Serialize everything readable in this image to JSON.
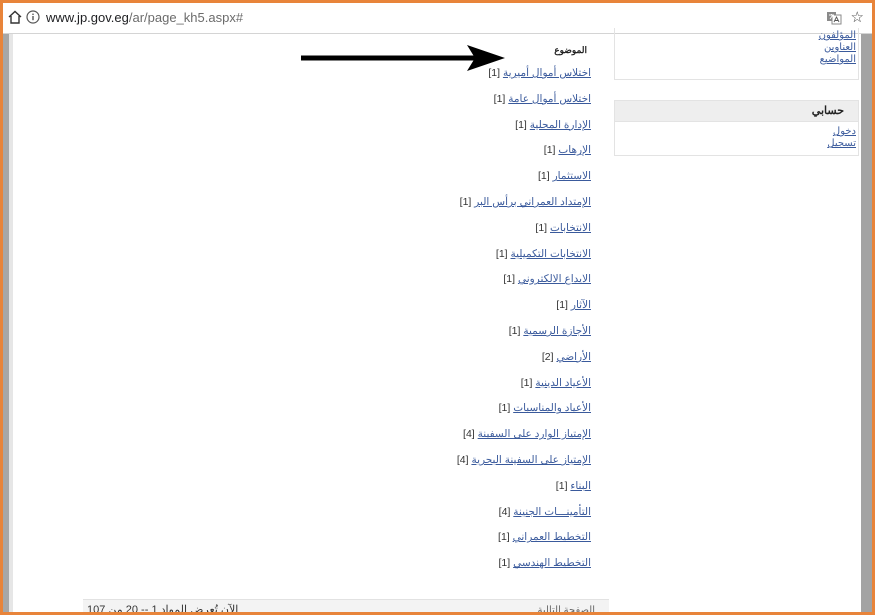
{
  "browser": {
    "url_host": "www.jp.gov.eg",
    "url_path": "/ar/page_kh5.aspx#"
  },
  "main": {
    "column_title": "الموضوع",
    "topics": [
      {
        "label": "اختلاس أموال أميرية",
        "count": "[1]"
      },
      {
        "label": "اختلاس أموال عامة",
        "count": "[1]"
      },
      {
        "label": "الإدارة المحلية",
        "count": "[1]"
      },
      {
        "label": "الإرهاب",
        "count": "[1]"
      },
      {
        "label": "الاستثمار",
        "count": "[1]"
      },
      {
        "label": "الإمتداد العمراني برأس البر",
        "count": "[1]"
      },
      {
        "label": "الانتخابات",
        "count": "[1]"
      },
      {
        "label": "الانتخابات التكميلية",
        "count": "[1]"
      },
      {
        "label": "الايداع الالكتروني",
        "count": "[1]"
      },
      {
        "label": "الآثار",
        "count": "[1]"
      },
      {
        "label": "الأجازة الرسمية",
        "count": "[1]"
      },
      {
        "label": "الأراضي",
        "count": "[2]"
      },
      {
        "label": "الأعياد الدينية",
        "count": "[1]"
      },
      {
        "label": "الأعياد والمناسبات",
        "count": "[1]"
      },
      {
        "label": "الإمتياز الوارد على السفينة",
        "count": "[4]"
      },
      {
        "label": "الإمتياز على السفينة البحرية",
        "count": "[4]"
      },
      {
        "label": "البناء",
        "count": "[1]"
      },
      {
        "label": "التأمينـــات الجنينة",
        "count": "[4]"
      },
      {
        "label": "التخطيط العمراني",
        "count": "[1]"
      },
      {
        "label": "التخطيط الهندسي",
        "count": "[1]"
      }
    ],
    "pager": {
      "next_label": "الصفحة التالية",
      "count_text": "الآن تُعرض المواد 1 -- 20 من 107"
    }
  },
  "sidebar": {
    "links": [
      "المؤلفون",
      "العناوين",
      "المواضيع"
    ],
    "account": {
      "title": "حسابي",
      "links": [
        "دخول",
        "تسجيل"
      ]
    }
  },
  "colors": {
    "frame_border": "#e8843a",
    "link": "#3a5a9c",
    "arrow": "#000000"
  },
  "icons": {
    "home": "home-icon",
    "info": "info-icon",
    "translate": "translate-icon",
    "star": "star-icon"
  }
}
